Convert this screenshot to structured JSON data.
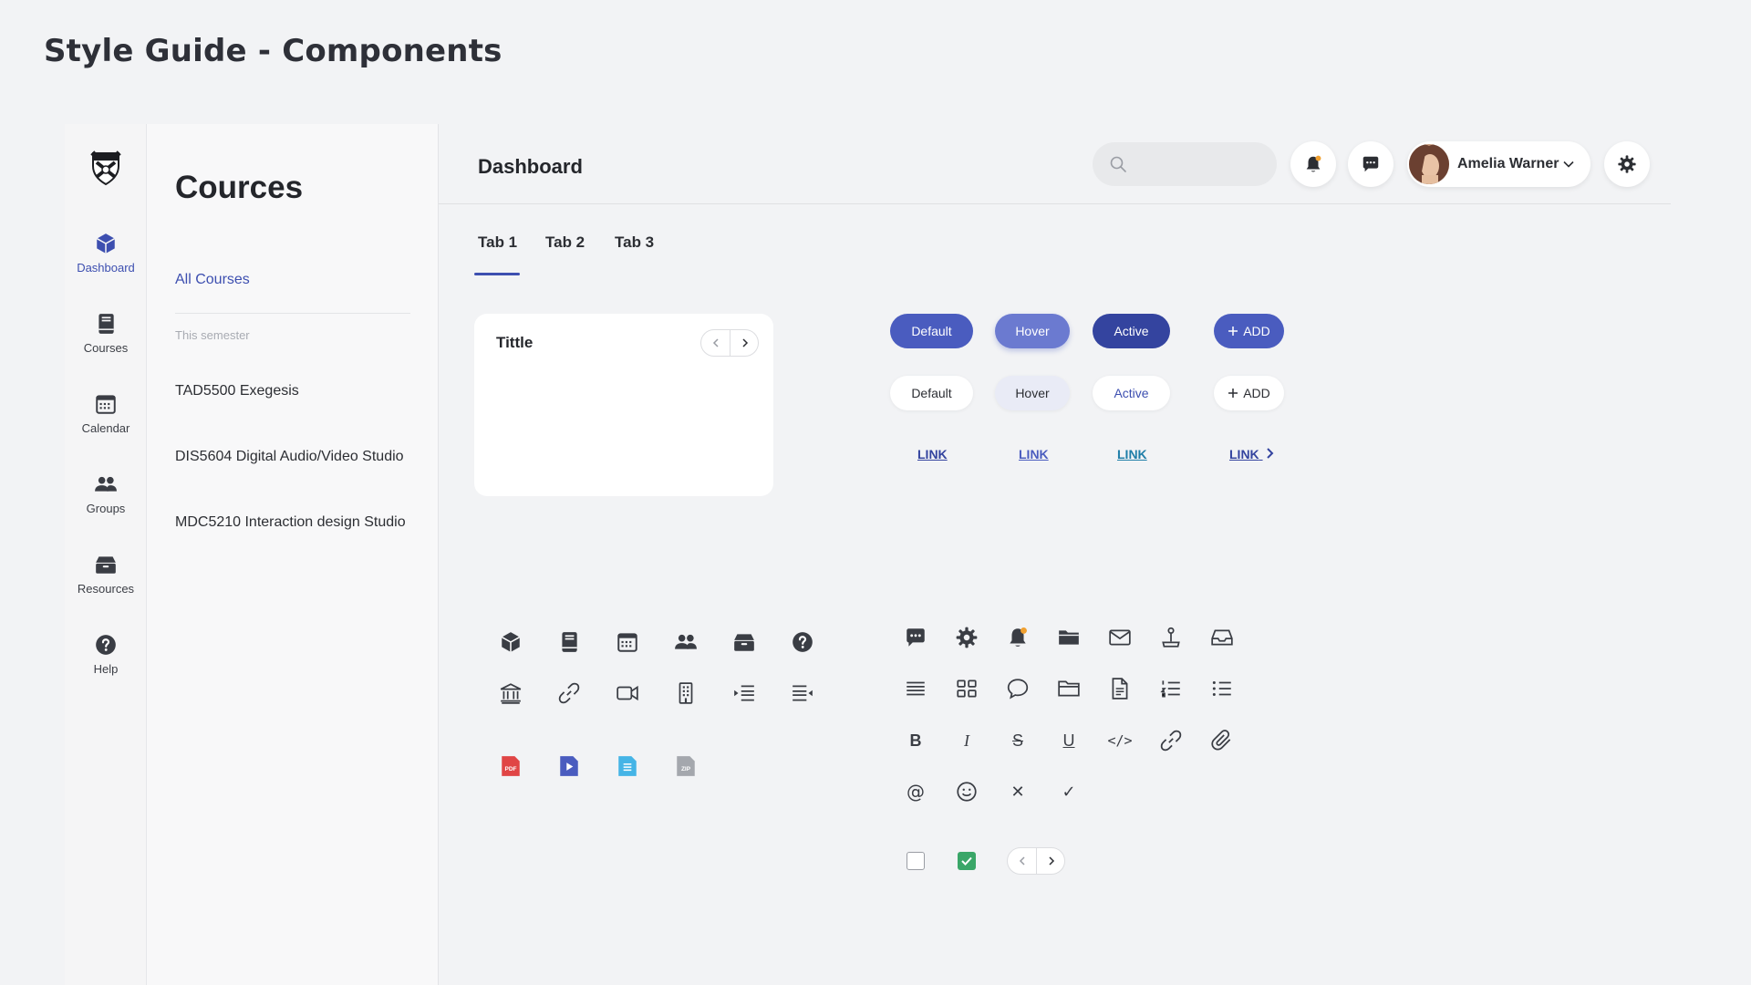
{
  "page_title": "Style Guide - Components",
  "rail": {
    "items": [
      {
        "label": "Dashboard",
        "icon": "cube-icon",
        "active": true
      },
      {
        "label": "Courses",
        "icon": "book-icon"
      },
      {
        "label": "Calendar",
        "icon": "calendar-icon"
      },
      {
        "label": "Groups",
        "icon": "groups-icon"
      },
      {
        "label": "Resources",
        "icon": "resources-box-icon"
      },
      {
        "label": "Help",
        "icon": "help-icon"
      }
    ]
  },
  "courses": {
    "title": "Cources",
    "all_courses": "All Courses",
    "semester_label": "This semester",
    "items": [
      "TAD5500 Exegesis",
      "DIS5604 Digital Audio/Video Studio",
      "MDC5210 Interaction design Studio"
    ]
  },
  "header": {
    "title": "Dashboard",
    "search_placeholder": "",
    "user_name": "Amelia Warner"
  },
  "tabs": [
    "Tab 1",
    "Tab 2",
    "Tab 3"
  ],
  "card": {
    "title": "Tittle"
  },
  "buttons": {
    "solid": [
      "Default",
      "Hover",
      "Active"
    ],
    "soft": [
      "Default",
      "Hover",
      "Active"
    ],
    "add": "ADD",
    "links": [
      "LINK",
      "LINK",
      "LINK",
      "LINK"
    ]
  },
  "colors": {
    "accent": "#4a5cbf",
    "accent_hover": "#6b7ad0",
    "accent_active": "#34449f",
    "link_default": "#34449f",
    "link_hover": "#4a5cbf",
    "link_active": "#1f7ea8",
    "notification_dot": "#f0a030",
    "checkbox_checked": "#3aa668"
  },
  "file_icons": [
    {
      "label": "PDF",
      "color": "#e04545"
    },
    {
      "label": "▶",
      "color": "#4a5cbf"
    },
    {
      "label": "≡",
      "color": "#45b4e6"
    },
    {
      "label": "ZIP",
      "color": "#a4a7ad"
    }
  ],
  "format_glyphs": {
    "bold": "B",
    "italic": "I",
    "strike": "S",
    "underline": "U",
    "code": "</>",
    "at": "@",
    "close": "✕",
    "check": "✓"
  }
}
